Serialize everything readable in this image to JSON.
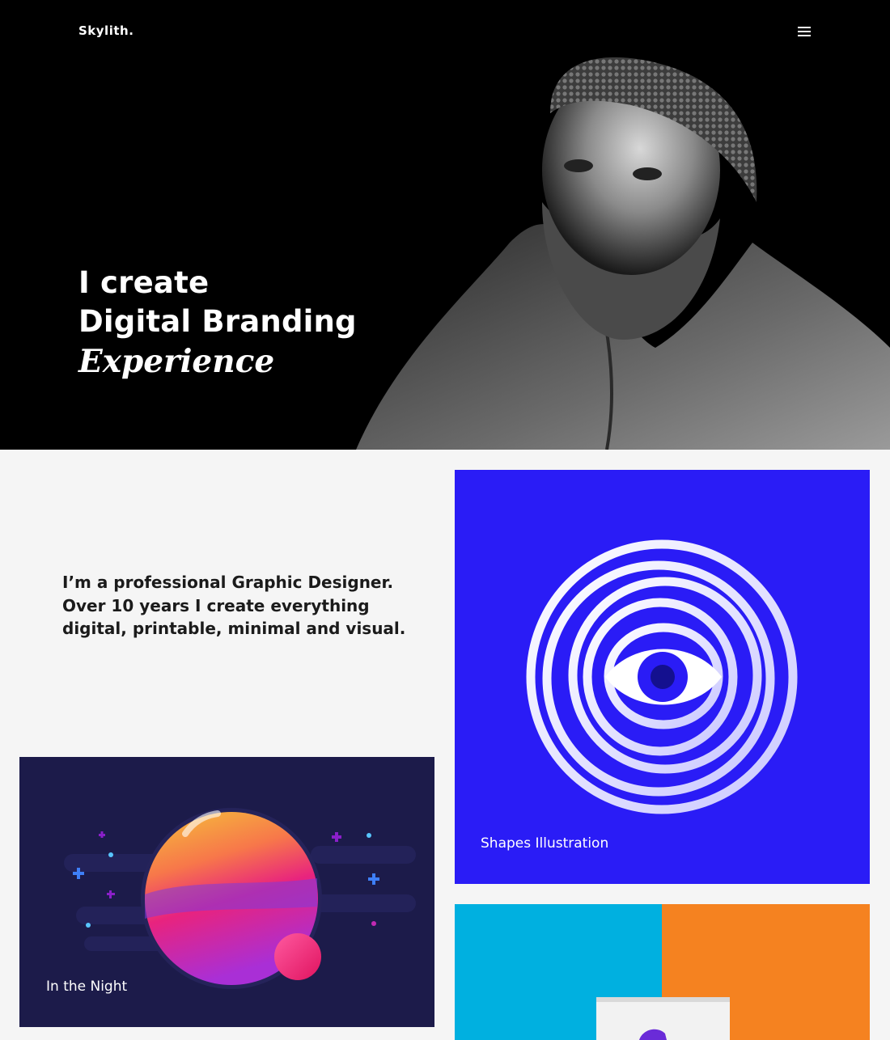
{
  "header": {
    "brand": "Skylith.",
    "menu_icon": "hamburger-menu-icon"
  },
  "hero": {
    "line1": "I create",
    "line2": "Digital Branding",
    "line3": "Experience"
  },
  "intro": {
    "text": "I’m a professional Graphic Designer. Over 10 years I create everything digital, printable, minimal and visual."
  },
  "portfolio": {
    "items": [
      {
        "title": "Shapes Illustration",
        "bg": "#2a1cf6"
      },
      {
        "title": "In the Night",
        "bg": "#1c1b4a"
      },
      {
        "title": "",
        "bg_left": "#00b0e0",
        "bg_right": "#f58220"
      }
    ]
  }
}
